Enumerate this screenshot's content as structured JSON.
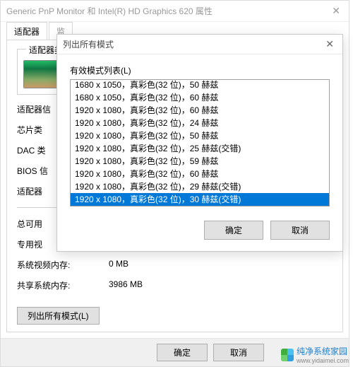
{
  "parent": {
    "title": "Generic PnP Monitor 和 Intel(R) HD Graphics 620 属性",
    "tabs": {
      "adapter": "适配器",
      "monitor_partial": "监"
    },
    "adapter_box_label": "适配器类",
    "rows": {
      "adapter_info": "适配器信",
      "chip_type": "芯片类",
      "dac_type": "DAC 类",
      "bios_info": "BIOS 信",
      "adapter_string": "适配器"
    },
    "mem": {
      "total_label": "总可用",
      "dedicated_label": "专用视",
      "system_video_label": "系统视频内存:",
      "system_video_value": "0 MB",
      "shared_label": "共享系统内存:",
      "shared_value": "3986 MB"
    },
    "list_all_modes_btn": "列出所有模式(L)",
    "ok": "确定",
    "cancel": "取消"
  },
  "modal": {
    "title": "列出所有模式",
    "list_label": "有效模式列表(L)",
    "items": [
      "1680 x 1050，真彩色(32 位)，50 赫兹",
      "1680 x 1050，真彩色(32 位)，60 赫兹",
      "1920 x 1080，真彩色(32 位)，60 赫兹",
      "1920 x 1080，真彩色(32 位)，24 赫兹",
      "1920 x 1080，真彩色(32 位)，50 赫兹",
      "1920 x 1080，真彩色(32 位)，25 赫兹(交错)",
      "1920 x 1080，真彩色(32 位)，59 赫兹",
      "1920 x 1080，真彩色(32 位)，60 赫兹",
      "1920 x 1080，真彩色(32 位)，29 赫兹(交错)",
      "1920 x 1080，真彩色(32 位)，30 赫兹(交错)"
    ],
    "selected_index": 9,
    "ok": "确定",
    "cancel": "取消"
  },
  "watermark": {
    "brand": "纯净系统家园",
    "url": "www.yidaimei.com"
  }
}
